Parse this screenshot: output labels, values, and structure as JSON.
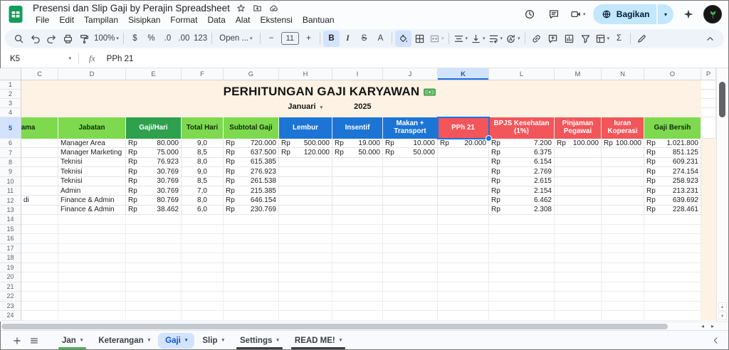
{
  "titlebar": {
    "doc_title": "Presensi dan Slip Gaji by Perajin Spreadsheet",
    "title_icons": [
      {
        "name": "star-icon",
        "svg": "star"
      },
      {
        "name": "move-folder-icon",
        "svg": "folder"
      },
      {
        "name": "cloud-status-icon",
        "svg": "cloud"
      }
    ],
    "menus": [
      "File",
      "Edit",
      "Tampilan",
      "Sisipkan",
      "Format",
      "Data",
      "Alat",
      "Ekstensi",
      "Bantuan"
    ],
    "right_icons": [
      {
        "name": "version-history-icon",
        "svg": "clock"
      },
      {
        "name": "comment-history-icon",
        "svg": "comment"
      },
      {
        "name": "meet-icon",
        "svg": "videocam",
        "caret": true
      }
    ],
    "share_label": "Bagikan"
  },
  "toolbar": {
    "items": [
      {
        "type": "icon",
        "name": "search-icon",
        "svg": "search"
      },
      {
        "type": "icon",
        "name": "undo-icon",
        "svg": "undo"
      },
      {
        "type": "icon",
        "name": "redo-icon",
        "svg": "redo"
      },
      {
        "type": "icon",
        "name": "print-icon",
        "svg": "print"
      },
      {
        "type": "icon",
        "name": "paint-format-icon",
        "svg": "paint"
      },
      {
        "type": "textbtn",
        "name": "zoom-select",
        "text": "100%",
        "caret": true
      },
      {
        "type": "sep"
      },
      {
        "type": "textbtn",
        "name": "format-currency-button",
        "text": "$"
      },
      {
        "type": "textbtn",
        "name": "format-percent-button",
        "text": "%"
      },
      {
        "type": "textbtn",
        "name": "decrease-decimal-button",
        "text": ".0"
      },
      {
        "type": "textbtn",
        "name": "increase-decimal-button",
        "text": ".00"
      },
      {
        "type": "textbtn",
        "name": "more-formats-button",
        "text": "123"
      },
      {
        "type": "sep"
      },
      {
        "type": "textbtn",
        "name": "font-select",
        "text": "Open ...",
        "caret": true,
        "wide": true
      },
      {
        "type": "sep"
      },
      {
        "type": "textbtn",
        "name": "decrease-font-size-button",
        "text": "−"
      },
      {
        "type": "textbtn",
        "name": "font-size-input",
        "text": "11",
        "box": true
      },
      {
        "type": "textbtn",
        "name": "increase-font-size-button",
        "text": "+"
      },
      {
        "type": "sep"
      },
      {
        "type": "textbtn",
        "name": "bold-button",
        "text": "B",
        "bold": true,
        "active": true
      },
      {
        "type": "textbtn",
        "name": "italic-button",
        "text": "I",
        "italic": true
      },
      {
        "type": "textbtn",
        "name": "strikethrough-button",
        "text": "S",
        "strike": true
      },
      {
        "type": "textbtn",
        "name": "text-color-button",
        "text": "A",
        "underline": "#e8d6bb"
      },
      {
        "type": "sep"
      },
      {
        "type": "icon",
        "name": "fill-color-icon",
        "svg": "fill",
        "active": true,
        "underline": "#e94235"
      },
      {
        "type": "icon",
        "name": "borders-icon",
        "svg": "borders"
      },
      {
        "type": "icon",
        "name": "merge-cells-icon",
        "svg": "merge",
        "muted": true,
        "caret": true
      },
      {
        "type": "sep"
      },
      {
        "type": "icon",
        "name": "horizontal-align-icon",
        "svg": "align",
        "caret": true
      },
      {
        "type": "icon",
        "name": "vertical-align-icon",
        "svg": "valign",
        "caret": true
      },
      {
        "type": "icon",
        "name": "text-wrap-icon",
        "svg": "wrap",
        "caret": true
      },
      {
        "type": "icon",
        "name": "text-rotation-icon",
        "svg": "rotate",
        "caret": true
      },
      {
        "type": "sep"
      },
      {
        "type": "icon",
        "name": "insert-link-icon",
        "svg": "link"
      },
      {
        "type": "icon",
        "name": "insert-comment-icon",
        "svg": "comment-add"
      },
      {
        "type": "icon",
        "name": "insert-chart-icon",
        "svg": "chart"
      },
      {
        "type": "icon",
        "name": "create-filter-icon",
        "svg": "filter"
      },
      {
        "type": "icon",
        "name": "table-views-icon",
        "svg": "views",
        "caret": true
      },
      {
        "type": "textbtn",
        "name": "functions-button",
        "text": "Σ"
      },
      {
        "type": "sep"
      },
      {
        "type": "icon",
        "name": "editing-mode-icon",
        "svg": "pen"
      }
    ]
  },
  "formula_bar": {
    "name_box": "K5",
    "fx_label": "fx",
    "formula": "PPh 21"
  },
  "grid": {
    "columns": [
      "C",
      "D",
      "E",
      "F",
      "G",
      "H",
      "I",
      "J",
      "K",
      "L",
      "M",
      "N",
      "O",
      "P"
    ],
    "selected_column": "K",
    "selected_row": 5,
    "selected_cell": "K5",
    "title": "PERHITUNGAN GAJI KARYAWAN",
    "period_month": "Januari",
    "period_year": "2025",
    "currency": "Rp",
    "first_row": 1,
    "last_row": 24,
    "header": [
      {
        "label": "Nama",
        "bg": "hg"
      },
      {
        "label": "Jabatan",
        "bg": "hg"
      },
      {
        "label": "Gaji/Hari",
        "bg": "hgd"
      },
      {
        "label": "Total Hari",
        "bg": "hg"
      },
      {
        "label": "Subtotal Gaji",
        "bg": "hg"
      },
      {
        "label": "Lembur",
        "bg": "hb"
      },
      {
        "label": "Insentif",
        "bg": "hb"
      },
      {
        "label": "Makan + Transport",
        "bg": "hb"
      },
      {
        "label": "PPh 21",
        "bg": "hr"
      },
      {
        "label": "BPJS Kesehatan (1%)",
        "bg": "hr"
      },
      {
        "label": "Pinjaman Pegawai",
        "bg": "hr"
      },
      {
        "label": "Iuran Koperasi",
        "bg": "hr"
      },
      {
        "label": "Gaji Bersih",
        "bg": "hg"
      }
    ],
    "rows": [
      [
        "",
        "Manager Area",
        "80.000",
        "9,0",
        "720.000",
        "500.000",
        "19.000",
        "10.000",
        "20.000",
        "7.200",
        "100.000",
        "100.000",
        "1.021.800"
      ],
      [
        "",
        "Manager Marketing",
        "75.000",
        "8,5",
        "637.500",
        "120.000",
        "50.000",
        "50.000",
        "",
        "6.375",
        "",
        "",
        "851.125"
      ],
      [
        "",
        "Teknisi",
        "76.923",
        "8,0",
        "615.385",
        "",
        "",
        "",
        "",
        "6.154",
        "",
        "",
        "609.231"
      ],
      [
        "",
        "Teknisi",
        "30.769",
        "9,0",
        "276.923",
        "",
        "",
        "",
        "",
        "2.769",
        "",
        "",
        "274.154"
      ],
      [
        "",
        "Teknisi",
        "30.769",
        "8,5",
        "261.538",
        "",
        "",
        "",
        "",
        "2.615",
        "",
        "",
        "258.923"
      ],
      [
        "",
        "Admin",
        "30.769",
        "7,0",
        "215.385",
        "",
        "",
        "",
        "",
        "2.154",
        "",
        "",
        "213.231"
      ],
      [
        "di",
        "Finance & Admin",
        "80.769",
        "8,0",
        "646.154",
        "",
        "",
        "",
        "",
        "6.462",
        "",
        "",
        "639.692"
      ],
      [
        "",
        "Finance & Admin",
        "38.462",
        "6,0",
        "230.769",
        "",
        "",
        "",
        "",
        "2.308",
        "",
        "",
        "228.461"
      ]
    ]
  },
  "sheetbar": {
    "tabs": [
      {
        "label": "Jan",
        "color": "green"
      },
      {
        "label": "Keterangan"
      },
      {
        "label": "Gaji",
        "active": true
      },
      {
        "label": "Slip"
      },
      {
        "label": "Settings",
        "color": "dark"
      },
      {
        "label": "READ ME!",
        "color": "dark"
      }
    ]
  }
}
